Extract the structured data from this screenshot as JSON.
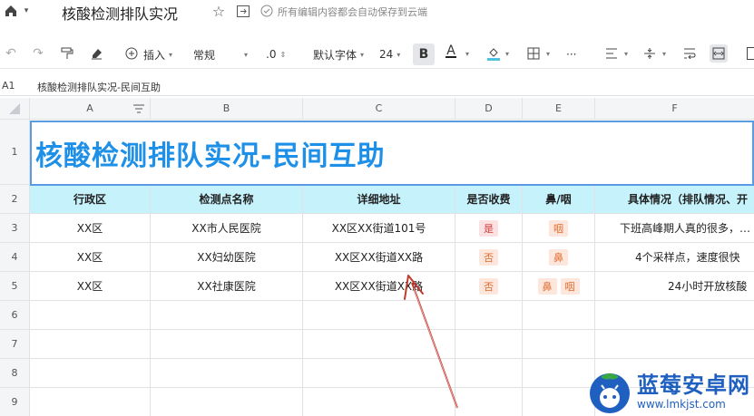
{
  "doc": {
    "title": "核酸检测排队实况",
    "autosave": "所有编辑内容都会自动保存到云端"
  },
  "toolbar": {
    "insert_label": "插入",
    "format_label": "常规",
    "decimal_label": ".0",
    "font_label": "默认字体",
    "size_label": "24",
    "bold_label": "B",
    "color_label": "A",
    "more_label": "···"
  },
  "formula": {
    "cell_ref": "A1",
    "content": "核酸检测排队实况-民间互助"
  },
  "columns": [
    "A",
    "B",
    "C",
    "D",
    "E",
    "F"
  ],
  "rows": [
    "1",
    "2",
    "3",
    "4",
    "5",
    "6",
    "7",
    "8",
    "9"
  ],
  "sheet": {
    "title": "核酸检测排队实况-民间互助",
    "headers": [
      "行政区",
      "检测点名称",
      "详细地址",
      "是否收费",
      "鼻/咽",
      "具体情况（排队情况、开"
    ],
    "data": [
      {
        "district": "XX区",
        "site": "XX市人民医院",
        "address": "XX区XX街道101号",
        "fee": "是",
        "type": [
          "咽"
        ],
        "detail": "下班高峰期人真的很多，…"
      },
      {
        "district": "XX区",
        "site": "XX妇幼医院",
        "address": "XX区XX街道XX路",
        "fee": "否",
        "type": [
          "鼻"
        ],
        "detail": "4个采样点，速度很快"
      },
      {
        "district": "XX区",
        "site": "XX社康医院",
        "address": "XX区XX街道XX路",
        "fee": "否",
        "type": [
          "鼻",
          "咽"
        ],
        "detail": "24小时开放核酸"
      }
    ]
  },
  "watermark": {
    "name": "蓝莓安卓网",
    "url": "www.lmkjst.com"
  },
  "colors": {
    "header_fill": "#c6f2fc",
    "title_color": "#1e90e8",
    "annotation_arrow": "#c0392b"
  }
}
